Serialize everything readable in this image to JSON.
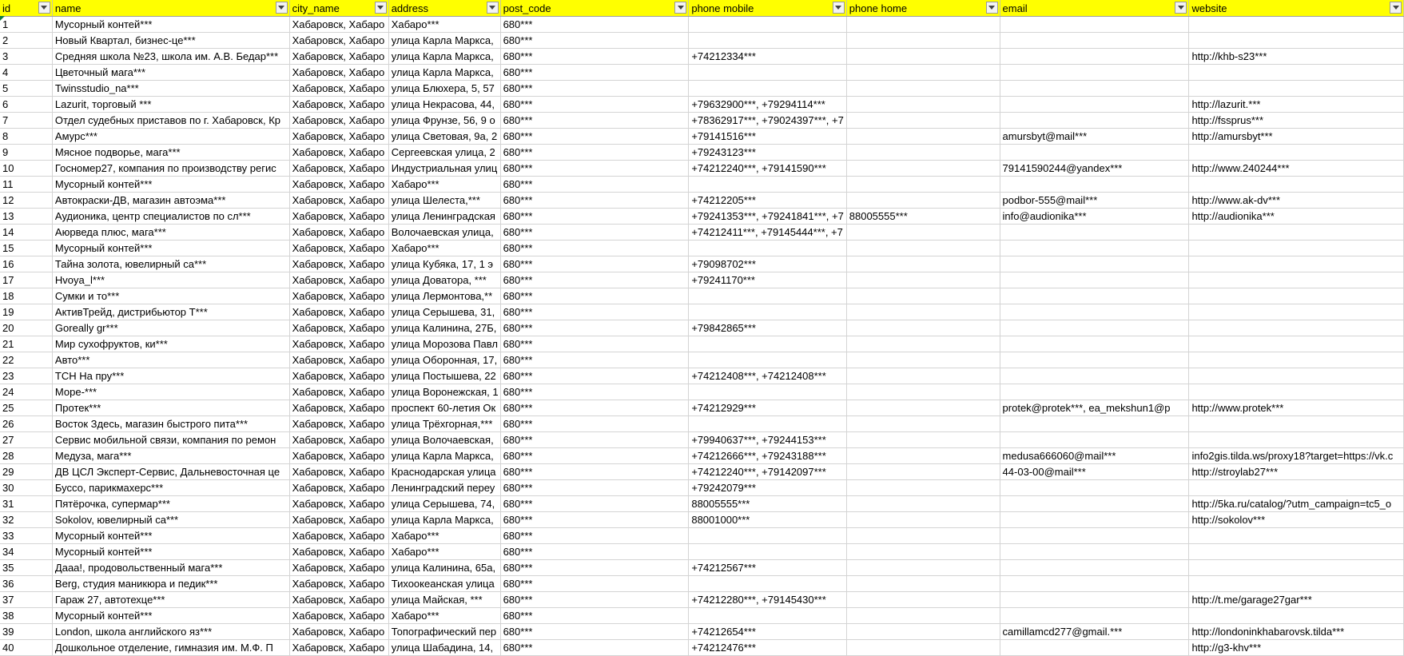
{
  "columns": [
    {
      "key": "id",
      "label": "id"
    },
    {
      "key": "name",
      "label": "name"
    },
    {
      "key": "city_name",
      "label": "city_name"
    },
    {
      "key": "address",
      "label": "address"
    },
    {
      "key": "post_code",
      "label": "post_code"
    },
    {
      "key": "phone_mobile",
      "label": "phone mobile"
    },
    {
      "key": "phone_home",
      "label": "phone home"
    },
    {
      "key": "email",
      "label": "email"
    },
    {
      "key": "website",
      "label": "website"
    }
  ],
  "rows": [
    [
      "1",
      "Мусорный контей***",
      "Хабаровск, Хабаро",
      "Хабаро***",
      "680***",
      "",
      "",
      "",
      ""
    ],
    [
      "2",
      "Новый Квартал, бизнес-це***",
      "Хабаровск, Хабаро",
      "улица Карла Маркса,",
      "680***",
      "",
      "",
      "",
      ""
    ],
    [
      "3",
      "Средняя школа №23, школа им. А.В. Бедар***",
      "Хабаровск, Хабаро",
      "улица Карла Маркса,",
      "680***",
      "+74212334***",
      "",
      "",
      "http://khb-s23***"
    ],
    [
      "4",
      "Цветочный мага***",
      "Хабаровск, Хабаро",
      "улица Карла Маркса,",
      "680***",
      "",
      "",
      "",
      ""
    ],
    [
      "5",
      "Twinsstudio_na***",
      "Хабаровск, Хабаро",
      "улица Блюхера, 5, 57",
      "680***",
      "",
      "",
      "",
      ""
    ],
    [
      "6",
      "Lazurit, торговый ***",
      "Хабаровск, Хабаро",
      "улица Некрасова, 44,",
      "680***",
      "+79632900***, +79294114***",
      "",
      "",
      "http://lazurit.***"
    ],
    [
      "7",
      "Отдел судебных приставов по г. Хабаровск, Кр",
      "Хабаровск, Хабаро",
      "улица Фрунзе, 56, 9 о",
      "680***",
      "+78362917***, +79024397***, +7",
      "",
      "",
      "http://fssprus***"
    ],
    [
      "8",
      "Амурс***",
      "Хабаровск, Хабаро",
      "улица Световая, 9а, 2",
      "680***",
      "+79141516***",
      "",
      "amursbyt@mail***",
      "http://amursbyt***"
    ],
    [
      "9",
      "Мясное подворье, мага***",
      "Хабаровск, Хабаро",
      "Сергеевская улица, 2",
      "680***",
      "+79243123***",
      "",
      "",
      ""
    ],
    [
      "10",
      "Госномер27, компания по производству регис",
      "Хабаровск, Хабаро",
      "Индустриальная улиц",
      "680***",
      "+74212240***, +79141590***",
      "",
      "79141590244@yandex***",
      "http://www.240244***"
    ],
    [
      "11",
      "Мусорный контей***",
      "Хабаровск, Хабаро",
      "Хабаро***",
      "680***",
      "",
      "",
      "",
      ""
    ],
    [
      "12",
      "Автокраски-ДВ, магазин автоэма***",
      "Хабаровск, Хабаро",
      "улица Шелеста,***",
      "680***",
      "+74212205***",
      "",
      "podbor-555@mail***",
      "http://www.ak-dv***"
    ],
    [
      "13",
      "Аудионика, центр специалистов по сл***",
      "Хабаровск, Хабаро",
      "улица Ленинградская",
      "680***",
      "+79241353***, +79241841***, +7",
      "88005555***",
      "info@audionika***",
      "http://audionika***"
    ],
    [
      "14",
      "Аюрведа плюс, мага***",
      "Хабаровск, Хабаро",
      "Волочаевская улица,",
      "680***",
      "+74212411***, +79145444***, +7",
      "",
      "",
      ""
    ],
    [
      "15",
      "Мусорный контей***",
      "Хабаровск, Хабаро",
      "Хабаро***",
      "680***",
      "",
      "",
      "",
      ""
    ],
    [
      "16",
      "Тайна золота, ювелирный са***",
      "Хабаровск, Хабаро",
      "улица Кубяка, 17, 1 э",
      "680***",
      "+79098702***",
      "",
      "",
      ""
    ],
    [
      "17",
      "Hvoya_l***",
      "Хабаровск, Хабаро",
      "улица Доватора, ***",
      "680***",
      "+79241170***",
      "",
      "",
      ""
    ],
    [
      "18",
      "Сумки и то***",
      "Хабаровск, Хабаро",
      "улица Лермонтова,**",
      "680***",
      "",
      "",
      "",
      ""
    ],
    [
      "19",
      "АктивТрейд, дистрибьютор T***",
      "Хабаровск, Хабаро",
      "улица Серышева, 31,",
      "680***",
      "",
      "",
      "",
      ""
    ],
    [
      "20",
      "Goreally gr***",
      "Хабаровск, Хабаро",
      "улица Калинина, 27Б,",
      "680***",
      "+79842865***",
      "",
      "",
      ""
    ],
    [
      "21",
      "Мир сухофруктов, ки***",
      "Хабаровск, Хабаро",
      "улица Морозова Павл",
      "680***",
      "",
      "",
      "",
      ""
    ],
    [
      "22",
      "Авто***",
      "Хабаровск, Хабаро",
      "улица Оборонная, 17,",
      "680***",
      "",
      "",
      "",
      ""
    ],
    [
      "23",
      "ТСН На пру***",
      "Хабаровск, Хабаро",
      "улица Постышева, 22",
      "680***",
      "+74212408***, +74212408***",
      "",
      "",
      ""
    ],
    [
      "24",
      "Море-***",
      "Хабаровск, Хабаро",
      "улица Воронежская, 1",
      "680***",
      "",
      "",
      "",
      ""
    ],
    [
      "25",
      "Протек***",
      "Хабаровск, Хабаро",
      "проспект 60-летия Ок",
      "680***",
      "+74212929***",
      "",
      "protek@protek***, ea_mekshun1@p",
      "http://www.protek***"
    ],
    [
      "26",
      "Восток Здесь, магазин быстрого пита***",
      "Хабаровск, Хабаро",
      "улица Трёхгорная,***",
      "680***",
      "",
      "",
      "",
      ""
    ],
    [
      "27",
      "Сервис мобильной связи, компания по ремон",
      "Хабаровск, Хабаро",
      "улица Волочаевская,",
      "680***",
      "+79940637***, +79244153***",
      "",
      "",
      ""
    ],
    [
      "28",
      "Медуза, мага***",
      "Хабаровск, Хабаро",
      "улица Карла Маркса,",
      "680***",
      "+74212666***, +79243188***",
      "",
      "medusa666060@mail***",
      "info2gis.tilda.ws/proxy18?target=https://vk.c"
    ],
    [
      "29",
      "ДВ ЦСЛ Эксперт-Сервис, Дальневосточная це",
      "Хабаровск, Хабаро",
      "Краснодарская улица",
      "680***",
      "+74212240***, +79142097***",
      "",
      "44-03-00@mail***",
      "http://stroylab27***"
    ],
    [
      "30",
      "Буссо, парикмахерс***",
      "Хабаровск, Хабаро",
      "Ленинградский переу",
      "680***",
      "+79242079***",
      "",
      "",
      ""
    ],
    [
      "31",
      "Пятёрочка, супермар***",
      "Хабаровск, Хабаро",
      "улица Серышева, 74,",
      "680***",
      "88005555***",
      "",
      "",
      "http://5ka.ru/catalog/?utm_campaign=tc5_o"
    ],
    [
      "32",
      "Sokolov, ювелирный са***",
      "Хабаровск, Хабаро",
      "улица Карла Маркса,",
      "680***",
      "88001000***",
      "",
      "",
      "http://sokolov***"
    ],
    [
      "33",
      "Мусорный контей***",
      "Хабаровск, Хабаро",
      "Хабаро***",
      "680***",
      "",
      "",
      "",
      ""
    ],
    [
      "34",
      "Мусорный контей***",
      "Хабаровск, Хабаро",
      "Хабаро***",
      "680***",
      "",
      "",
      "",
      ""
    ],
    [
      "35",
      "Дааа!, продовольственный мага***",
      "Хабаровск, Хабаро",
      "улица Калинина, 65а,",
      "680***",
      "+74212567***",
      "",
      "",
      ""
    ],
    [
      "36",
      "Berg, студия маникюра и педик***",
      "Хабаровск, Хабаро",
      "Тихоокеанская улица",
      "680***",
      "",
      "",
      "",
      ""
    ],
    [
      "37",
      "Гараж 27, автотехце***",
      "Хабаровск, Хабаро",
      "улица Майская, ***",
      "680***",
      "+74212280***, +79145430***",
      "",
      "",
      "http://t.me/garage27gar***"
    ],
    [
      "38",
      "Мусорный контей***",
      "Хабаровск, Хабаро",
      "Хабаро***",
      "680***",
      "",
      "",
      "",
      ""
    ],
    [
      "39",
      "London, школа английского яз***",
      "Хабаровск, Хабаро",
      "Топографический пер",
      "680***",
      "+74212654***",
      "",
      "camillamcd277@gmail.***",
      "http://londoninkhabarovsk.tilda***"
    ],
    [
      "40",
      "Дошкольное отделение, гимназия им. М.Ф. П",
      "Хабаровск, Хабаро",
      "улица Шабадина, 14,",
      "680***",
      "+74212476***",
      "",
      "",
      "http://g3-khv***"
    ]
  ],
  "colors": {
    "header_bg": "#ffff00",
    "grid_line": "#d4d4d4",
    "corner_mark": "#107c41"
  },
  "icons": {
    "filter": "filter-dropdown-icon"
  }
}
